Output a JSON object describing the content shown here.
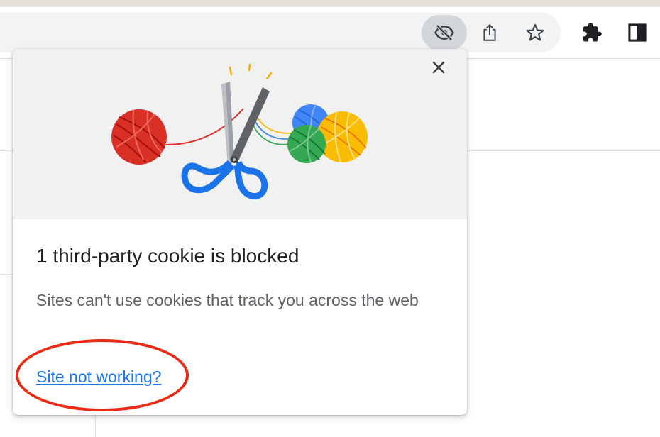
{
  "toolbar": {
    "icons": [
      "eye-off-icon",
      "share-icon",
      "star-icon",
      "extensions-puzzle-icon",
      "side-panel-icon"
    ]
  },
  "bubble": {
    "title": "1 third-party cookie is blocked",
    "description": "Sites can't use cookies that track you across the web",
    "link_label": "Site not working?",
    "close_icon": "close-icon",
    "illustration": "scissors-cutting-yarn-illustration"
  },
  "colors": {
    "link": "#1a73e8",
    "annotation": "#ea2a14",
    "yarn_red": "#d93025",
    "yarn_blue": "#4285f4",
    "yarn_green": "#34a853",
    "yarn_yellow": "#fbbc04",
    "scissor_handle": "#1a73e8"
  }
}
